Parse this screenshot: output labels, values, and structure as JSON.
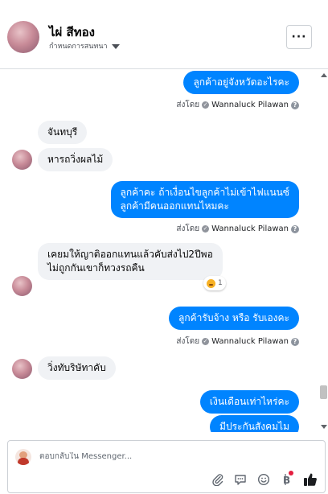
{
  "header": {
    "contact_name": "ไผ่ สีทอง",
    "assign_label": "กำหนดการสนทนา",
    "more_label": "···"
  },
  "messages": [
    {
      "direction": "out",
      "text": "ลูกค้าอยู่จังหวัดอะไรคะ"
    },
    {
      "direction": "in",
      "text": "จันทบุรี"
    },
    {
      "direction": "in",
      "text": "หารถวิ่งผลไม้"
    },
    {
      "direction": "out",
      "lines": [
        "ลูกค้าคะ  ถ้าเงื่อนไขลูกค้าไม่เข้าไฟแนนซ์",
        "ลูกค้ามีคนออกแทนไหมคะ"
      ]
    },
    {
      "direction": "in",
      "lines": [
        "เคยมให้ญาติออกแทนแล้วคับส่งไป2ปีพอ",
        "ไม่ถูกกันเขาก็ทวงรถคืน"
      ],
      "reaction_count": "1"
    },
    {
      "direction": "out",
      "text": "ลูกค้ารับจ้าง  หรือ  รับเองคะ"
    },
    {
      "direction": "in",
      "text": "วิ่งทับริษัทาคับ"
    },
    {
      "direction": "out",
      "text": "เงินเดือนเท่าไหร่คะ"
    },
    {
      "direction": "out",
      "text": "มีประกันสังคมไม"
    }
  ],
  "sent_by": {
    "prefix": "ส่งโดย",
    "name": "Wannaluck Pilawan",
    "help_label": "?"
  },
  "composer": {
    "placeholder": "ตอบกลับใน Messenger...",
    "icons": [
      "attachment-icon",
      "sticker-icon",
      "emoji-icon",
      "quick-reply-icon",
      "like-icon"
    ]
  },
  "colors": {
    "outgoing_bubble": "#0084ff",
    "incoming_bubble": "#f0f2f5",
    "like_icon": "#1c1e21"
  }
}
